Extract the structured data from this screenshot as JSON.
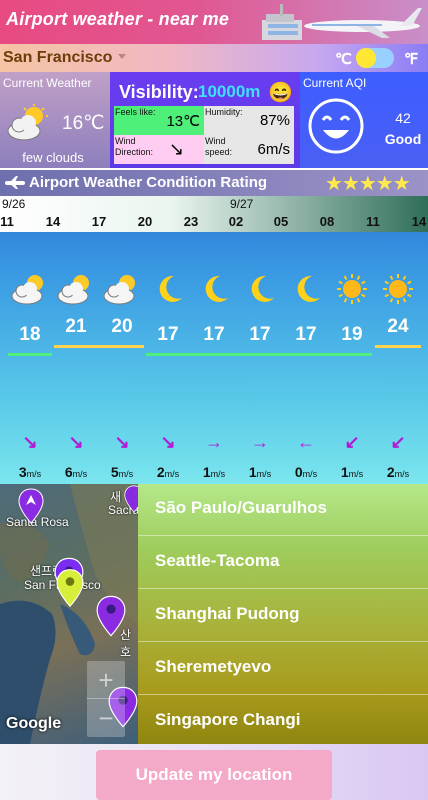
{
  "header": {
    "title": "Airport weather - near me"
  },
  "location": {
    "city": "San Francisco",
    "unit_c": "℃",
    "unit_f": "℉",
    "unit_selected": "C"
  },
  "current_weather": {
    "label": "Current Weather",
    "temp": "16℃",
    "desc": "few clouds",
    "icon": "partly-cloudy-icon"
  },
  "visibility": {
    "label": "Visibility:",
    "value": "10000m",
    "emoji": "😄",
    "feels_like_label": "Feels like:",
    "feels_like": "13℃",
    "humidity_label": "Humidity:",
    "humidity": "87%",
    "wind_dir_label": "Wind Direction:",
    "wind_dir_icon": "↘",
    "wind_speed_label": "Wind speed:",
    "wind_speed": "6m/s"
  },
  "aqi": {
    "label": "Current AQI",
    "value": "42",
    "status": "Good"
  },
  "rating": {
    "label": "Airport Weather Condition Rating",
    "stars": "★★★★★"
  },
  "forecast": {
    "date1": "9/26",
    "date2": "9/27",
    "hours": [
      "11",
      "14",
      "17",
      "20",
      "23",
      "02",
      "05",
      "08",
      "11",
      "14"
    ],
    "items": [
      {
        "icon": "partly-cloudy-icon",
        "temp": "18",
        "arrow": "↘",
        "speed": "3",
        "unit": "m/s"
      },
      {
        "icon": "partly-cloudy-icon",
        "temp": "21",
        "arrow": "↘",
        "speed": "6",
        "unit": "m/s"
      },
      {
        "icon": "partly-cloudy-icon",
        "temp": "20",
        "arrow": "↘",
        "speed": "5",
        "unit": "m/s"
      },
      {
        "icon": "moon-icon",
        "temp": "17",
        "arrow": "↘",
        "speed": "2",
        "unit": "m/s"
      },
      {
        "icon": "moon-icon",
        "temp": "17",
        "arrow": "→",
        "speed": "1",
        "unit": "m/s"
      },
      {
        "icon": "moon-icon",
        "temp": "17",
        "arrow": "→",
        "speed": "1",
        "unit": "m/s"
      },
      {
        "icon": "moon-icon",
        "temp": "17",
        "arrow": "←",
        "speed": "0",
        "unit": "m/s"
      },
      {
        "icon": "sun-icon",
        "temp": "19",
        "arrow": "↙",
        "speed": "1",
        "unit": "m/s"
      },
      {
        "icon": "sun-icon",
        "temp": "24",
        "arrow": "↙",
        "speed": "2",
        "unit": "m/s"
      }
    ]
  },
  "map": {
    "label_santarosa": "Santa Rosa",
    "label_sanfran": "San Francisco",
    "label_kor1": "샌프란",
    "label_kor2": "산호",
    "label_kor3": "새",
    "label_sac": "Sacra",
    "google": "Google",
    "zoom_in": "+",
    "zoom_out": "−"
  },
  "airports": [
    {
      "name": "São Paulo/Guarulhos"
    },
    {
      "name": "Seattle-Tacoma"
    },
    {
      "name": "Shanghai Pudong"
    },
    {
      "name": "Sheremetyevo"
    },
    {
      "name": "Singapore Changi"
    }
  ],
  "footer": {
    "button": "Update my location"
  },
  "colors": {
    "accent_pink": "#e84a82",
    "good_green": "#4ff07a",
    "wind_purple": "#b21ad8"
  }
}
